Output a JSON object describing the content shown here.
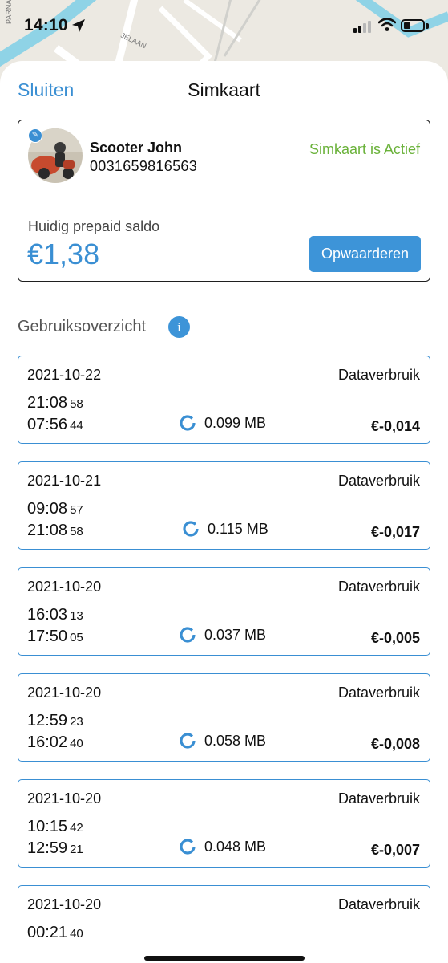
{
  "status_bar": {
    "time": "14:10"
  },
  "map": {
    "street_1": "PARNASS",
    "street_2": "JELAAN"
  },
  "nav": {
    "close_label": "Sluiten",
    "title": "Simkaart"
  },
  "profile": {
    "name": "Scooter John",
    "phone": "0031659816563",
    "sim_status": "Simkaart is Actief",
    "balance_label": "Huidig prepaid saldo",
    "balance": "€1,38",
    "topup_label": "Opwaarderen"
  },
  "usage": {
    "title": "Gebruiksoverzicht",
    "info_glyph": "i",
    "items": [
      {
        "date": "2021-10-22",
        "type": "Dataverbruik",
        "start": "21:08",
        "start_sec": "58",
        "end": "07:56",
        "end_sec": "44",
        "data": "0.099 MB",
        "cost": "€-0,014"
      },
      {
        "date": "2021-10-21",
        "type": "Dataverbruik",
        "start": "09:08",
        "start_sec": "57",
        "end": "21:08",
        "end_sec": "58",
        "data": "0.115 MB",
        "cost": "€-0,017"
      },
      {
        "date": "2021-10-20",
        "type": "Dataverbruik",
        "start": "16:03",
        "start_sec": "13",
        "end": "17:50",
        "end_sec": "05",
        "data": "0.037 MB",
        "cost": "€-0,005"
      },
      {
        "date": "2021-10-20",
        "type": "Dataverbruik",
        "start": "12:59",
        "start_sec": "23",
        "end": "16:02",
        "end_sec": "40",
        "data": "0.058 MB",
        "cost": "€-0,008"
      },
      {
        "date": "2021-10-20",
        "type": "Dataverbruik",
        "start": "10:15",
        "start_sec": "42",
        "end": "12:59",
        "end_sec": "21",
        "data": "0.048 MB",
        "cost": "€-0,007"
      },
      {
        "date": "2021-10-20",
        "type": "Dataverbruik",
        "start": "00:21",
        "start_sec": "40",
        "end": "",
        "end_sec": "",
        "data": "",
        "cost": ""
      }
    ]
  },
  "colors": {
    "accent": "#3a8fd3",
    "active": "#6ab23a",
    "card_border": "#1f1f1f"
  }
}
